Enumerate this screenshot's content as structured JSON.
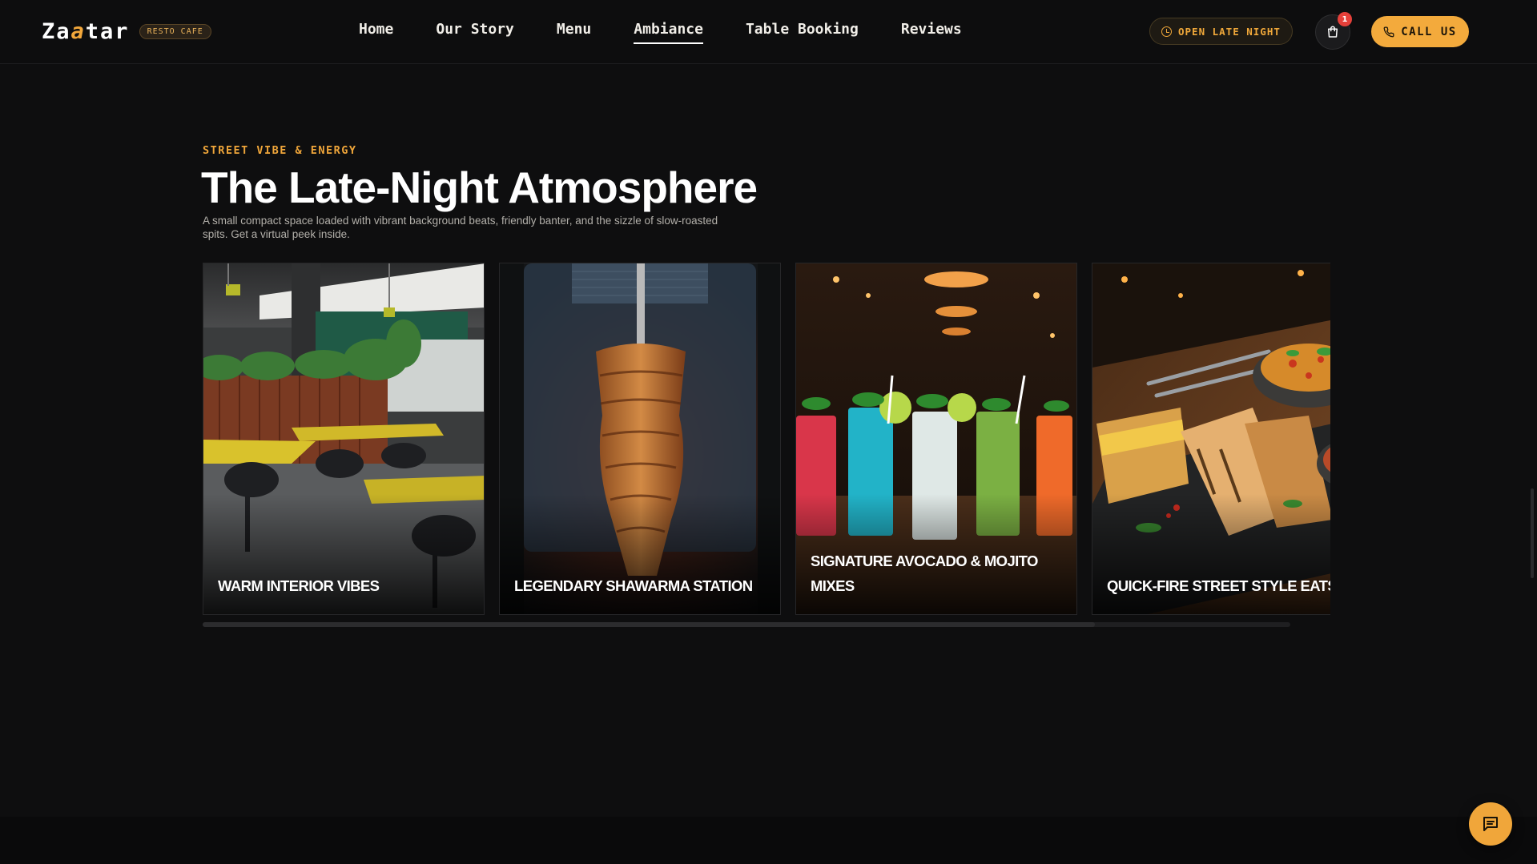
{
  "brand": {
    "name_start": "Za",
    "name_accent": "a",
    "name_end": "tar",
    "badge": "RESTO CAFE"
  },
  "nav": {
    "links": [
      {
        "label": "Home",
        "active": false
      },
      {
        "label": "Our Story",
        "active": false
      },
      {
        "label": "Menu",
        "active": false
      },
      {
        "label": "Ambiance",
        "active": true
      },
      {
        "label": "Table Booking",
        "active": false
      },
      {
        "label": "Reviews",
        "active": false
      }
    ],
    "open_label": "OPEN LATE NIGHT",
    "cart_count": "1",
    "call_label": "CALL US"
  },
  "section": {
    "eyebrow": "STREET VIBE & ENERGY",
    "title": "The Late-Night Atmosphere",
    "description": "A small compact space loaded with vibrant background beats, friendly banter, and the sizzle of slow-roasted spits. Get a virtual peek inside."
  },
  "gallery": {
    "cards": [
      {
        "caption": "WARM INTERIOR VIBES"
      },
      {
        "caption": "LEGENDARY SHAWARMA STATION"
      },
      {
        "caption": "SIGNATURE AVOCADO & MOJITO MIXES"
      },
      {
        "caption": "QUICK-FIRE STREET STYLE EATS"
      }
    ],
    "scroll_fraction": 0.82
  },
  "colors": {
    "accent": "#f3aa3c",
    "background": "#0e0e0f",
    "badge_red": "#e5403a"
  },
  "icons": {
    "clock": "clock-icon",
    "cart": "shopping-bag-icon",
    "phone": "phone-icon",
    "chat": "chat-icon"
  }
}
